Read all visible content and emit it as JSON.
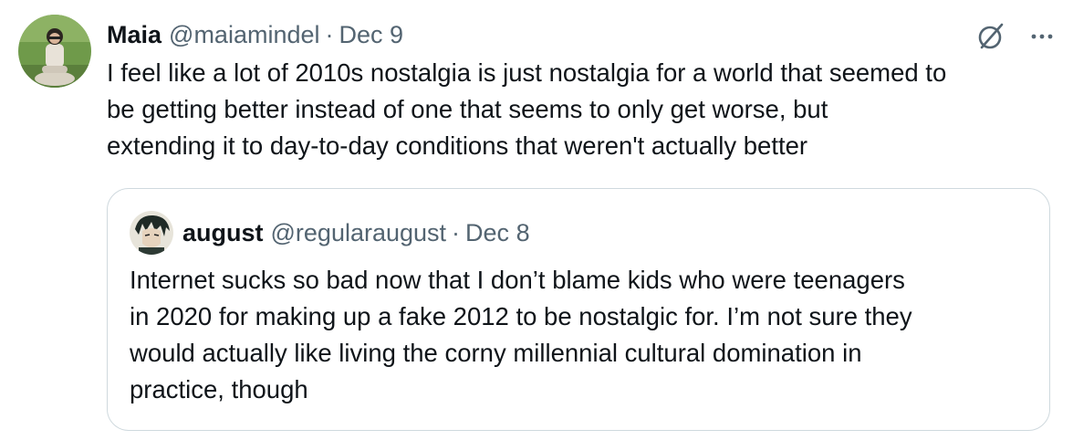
{
  "tweet": {
    "author_name": "Maia",
    "author_handle": "@maiamindel",
    "separator": "·",
    "date": "Dec 9",
    "text_lines": [
      "I feel like a lot of 2010s nostalgia is just nostalgia for a world that seemed to",
      "be getting better instead of one that seems to only get worse, but",
      "extending it to day-to-day conditions that weren't actually better"
    ],
    "icons": {
      "grok": "grok-icon",
      "more": "more-icon",
      "more_glyph": "···"
    }
  },
  "quote": {
    "author_name": "august",
    "author_handle": "@regularaugust",
    "separator": "·",
    "date": "Dec 8",
    "text_lines": [
      "Internet sucks so bad now that I don’t blame kids who were teenagers",
      "in 2020 for making up a fake 2012 to be nostalgic for. I’m not sure they",
      "would actually like living the corny millennial cultural domination in",
      "practice, though"
    ]
  },
  "colors": {
    "text": "#0f1419",
    "secondary": "#536471",
    "border": "#cfd9de"
  }
}
